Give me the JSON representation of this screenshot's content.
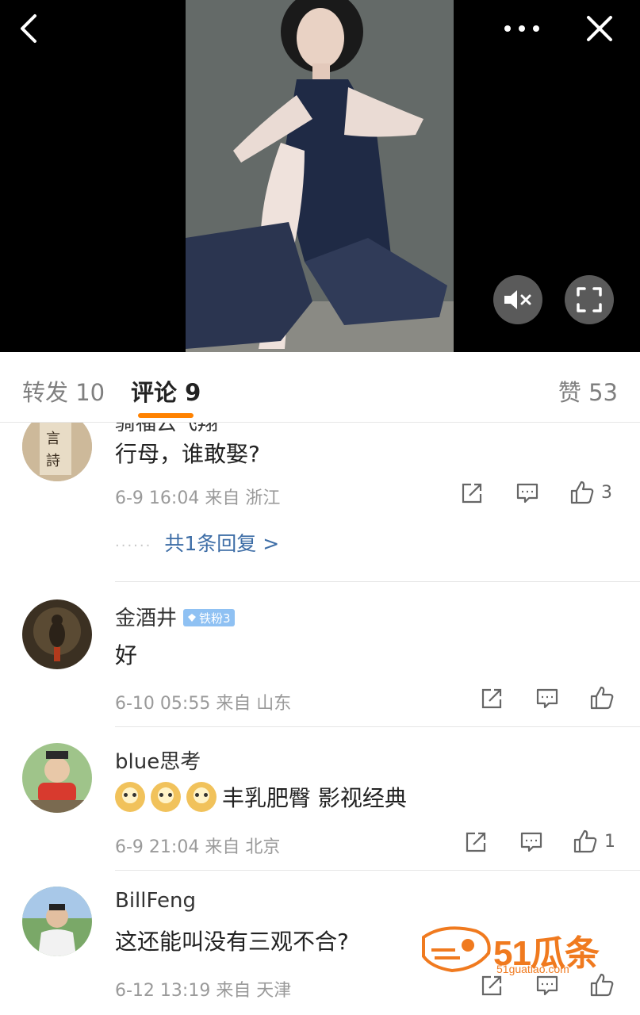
{
  "tabs": {
    "repost": "转发 10",
    "comment": "评论 9",
    "like": "赞 53"
  },
  "comments": [
    {
      "username": "骑福云飞翔",
      "text": "行母，谁敢娶?",
      "meta": "6-9 16:04  来自 浙江",
      "likes": "3",
      "replies": "共1条回复 >"
    },
    {
      "username": "金酒井",
      "badge": "铁粉3",
      "text": "好",
      "meta": "6-10 05:55  来自 山东",
      "likes": ""
    },
    {
      "username": "blue思考",
      "text": "丰乳肥臀 影视经典",
      "meta": "6-9 21:04  来自 北京",
      "likes": "1"
    },
    {
      "username": "BillFeng",
      "text": "这还能叫没有三观不合?",
      "meta": "6-12 13:19  来自 天津",
      "likes": ""
    }
  ],
  "watermark": {
    "brand": "51瓜条",
    "url": "51guatiao.com"
  },
  "colors": {
    "accent": "#ff8200",
    "link": "#3d6da6",
    "badge": "#8fc1f3"
  }
}
